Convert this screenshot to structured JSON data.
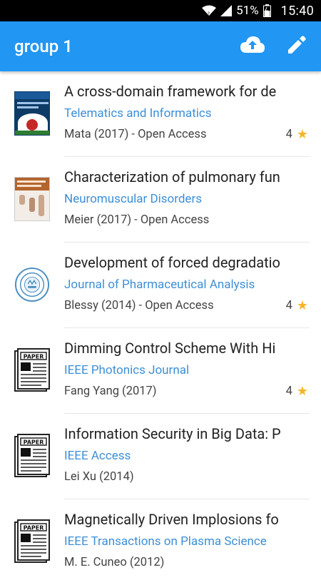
{
  "status_bar": {
    "battery_percent": "51%",
    "time": "15:40",
    "icons": [
      "wifi-icon",
      "signal-icon",
      "battery-icon"
    ]
  },
  "app_bar": {
    "title": "group 1",
    "actions": [
      "cloud-upload-icon",
      "edit-pencil-icon"
    ]
  },
  "colors": {
    "primary": "#2196f3",
    "journal_link": "#3d8fd6",
    "star": "#f5b42a"
  },
  "papers": [
    {
      "title": "A cross-domain framework for de",
      "journal": "Telematics and Informatics",
      "meta": "Mata (2017) - Open Access",
      "rating": "4",
      "thumb": "cover-telematics"
    },
    {
      "title": "Characterization of pulmonary fun",
      "journal": "Neuromuscular Disorders",
      "meta": "Meier (2017) - Open Access",
      "rating": "",
      "thumb": "cover-neuromuscular"
    },
    {
      "title": "Development of forced degradatio",
      "journal": "Journal of Pharmaceutical Analysis",
      "meta": "Blessy (2014) - Open Access",
      "rating": "4",
      "thumb": "cover-pharma-seal"
    },
    {
      "title": "Dimming Control Scheme With Hi",
      "journal": "IEEE Photonics Journal",
      "meta": "Fang Yang (2017)",
      "rating": "4",
      "thumb": "paper-icon"
    },
    {
      "title": "Information Security in Big Data: P",
      "journal": "IEEE Access",
      "meta": "Lei Xu (2014)",
      "rating": "",
      "thumb": "paper-icon"
    },
    {
      "title": "Magnetically Driven Implosions fo",
      "journal": "IEEE Transactions on Plasma Science",
      "meta": "M. E. Cuneo (2012)",
      "rating": "",
      "thumb": "paper-icon"
    }
  ],
  "paper_icon_label": "PAPER"
}
